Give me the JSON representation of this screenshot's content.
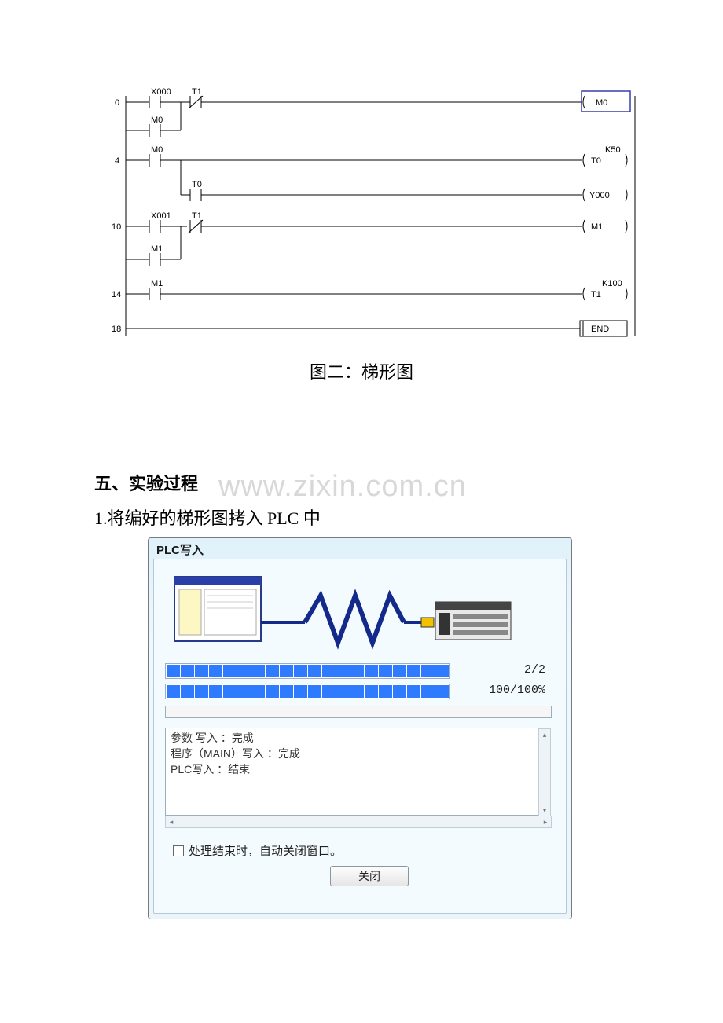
{
  "ladder": {
    "rows": {
      "r0_num": "0",
      "r0_c1": "X000",
      "r0_c2": "T1",
      "r0_out": "M0",
      "r0_b": "M0",
      "r4_num": "4",
      "r4_c1": "M0",
      "r4_k": "K50",
      "r4_out": "T0",
      "r4_b": "T0",
      "r4_out2": "Y000",
      "r10_num": "10",
      "r10_c1": "X001",
      "r10_c2": "T1",
      "r10_out": "M1",
      "r10_b": "M1",
      "r14_num": "14",
      "r14_c1": "M1",
      "r14_k": "K100",
      "r14_out": "T1",
      "r18_num": "18",
      "r18_out": "END"
    }
  },
  "caption": "图二：梯形图",
  "section_title": "五、实验过程",
  "watermark": "www.zixin.com.cn",
  "step1": "1.将编好的梯形图拷入 PLC 中",
  "dialog": {
    "title": "PLC写入",
    "progress1_label": "2/2",
    "progress2_label": "100/100%",
    "log_line1": "参数 写入 ：完成",
    "log_line2": "程序（MAIN）写入 ：完成",
    "log_line3": "PLC写入 ：结束",
    "checkbox_label": "处理结束时，自动关闭窗口。",
    "close_label": "关闭"
  }
}
